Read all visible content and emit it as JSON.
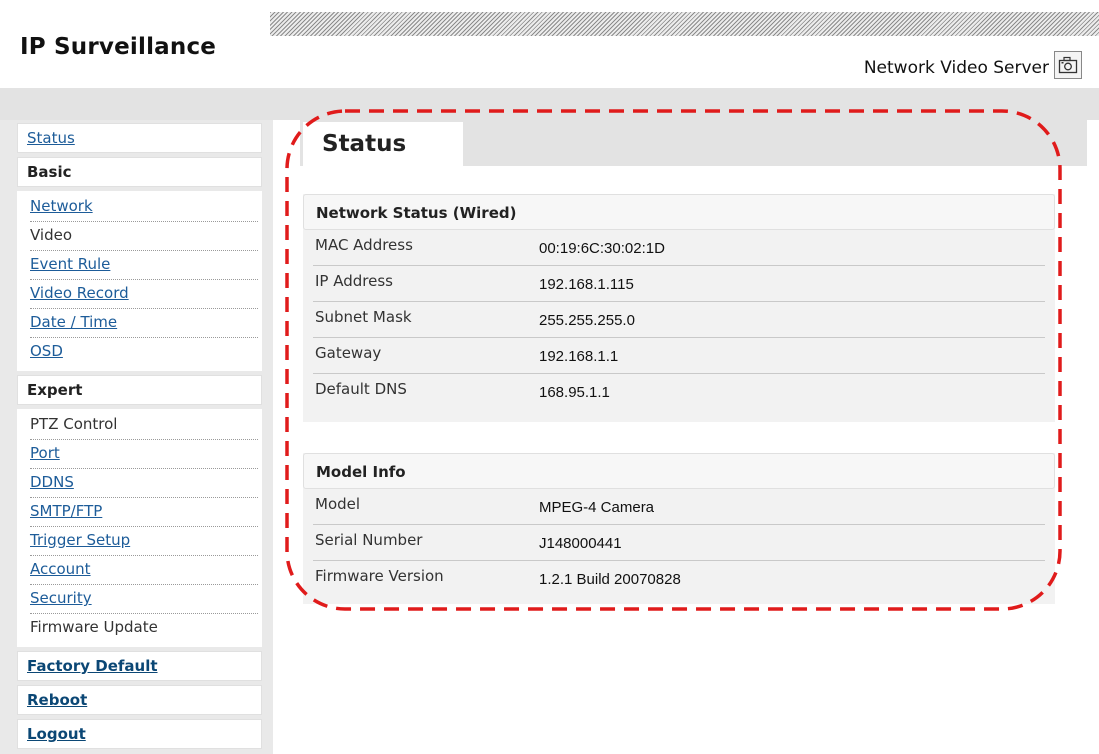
{
  "header": {
    "brand": "IP Surveillance",
    "server_title": "Network Video Server",
    "camera_icon": "camera-icon"
  },
  "sidebar": {
    "status": "Status",
    "basic_heading": "Basic",
    "basic_items": [
      "Network",
      "Video",
      "Event Rule",
      "Video Record",
      "Date / Time",
      "OSD"
    ],
    "expert_heading": "Expert",
    "expert_items": [
      "PTZ Control",
      "Port",
      "DDNS",
      "SMTP/FTP",
      "Trigger Setup",
      "Account",
      "Security",
      "Firmware Update"
    ],
    "factory_default": "Factory Default",
    "reboot": "Reboot",
    "logout": "Logout"
  },
  "main": {
    "tab_title": "Status",
    "network_status": {
      "heading": "Network Status (Wired)",
      "rows": [
        {
          "label": "MAC Address",
          "value": "00:19:6C:30:02:1D"
        },
        {
          "label": "IP Address",
          "value": "192.168.1.115"
        },
        {
          "label": "Subnet Mask",
          "value": "255.255.255.0"
        },
        {
          "label": "Gateway",
          "value": "192.168.1.1"
        },
        {
          "label": "Default DNS",
          "value": "168.95.1.1"
        }
      ]
    },
    "model_info": {
      "heading": "Model Info",
      "rows": [
        {
          "label": "Model",
          "value": "MPEG-4 Camera"
        },
        {
          "label": "Serial Number",
          "value": "J148000441"
        },
        {
          "label": "Firmware Version",
          "value": "1.2.1 Build 20070828"
        }
      ]
    }
  },
  "colors": {
    "link": "#1d5c99",
    "highlight_dash": "#e01b1b",
    "sidebar_bg": "#e9e9e9"
  }
}
